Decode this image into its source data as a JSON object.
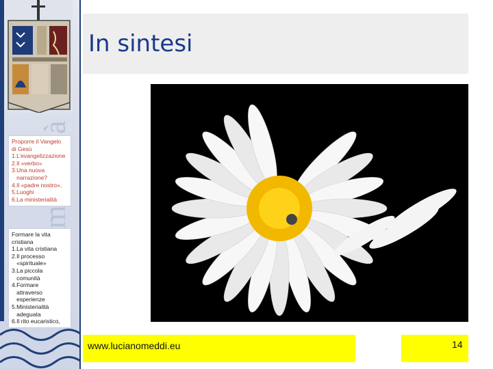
{
  "slide": {
    "title": "In sintesi",
    "footer_url": "www.lucianomeddi.eu",
    "page_number": "14"
  },
  "sidebar": {
    "section1": [
      "Proporre il Vangelo",
      "di Gesù",
      "1.L’evangelizzazione",
      "2.Il «verbo»",
      "3.Una nuova",
      "   narrazione?",
      "4.Il «padre nostro»,",
      "5.Luoghi",
      "6.La ministerialità"
    ],
    "section2": [
      "Formare la vita",
      "cristiana",
      "1.La vita cristiana",
      "2.Il processo",
      "   «spirituale»",
      "3.La piccola",
      "   comunità",
      "4.Formare",
      "   attraverso",
      "   esperienze",
      "5.Ministerialità",
      "   adeguata",
      "6.Il rito eucaristico,"
    ]
  },
  "colors": {
    "title": "#1a3a8a",
    "footer_bg": "#ffff00",
    "section1_text": "#c0392b",
    "sidebar_band": "#1f3f78"
  }
}
